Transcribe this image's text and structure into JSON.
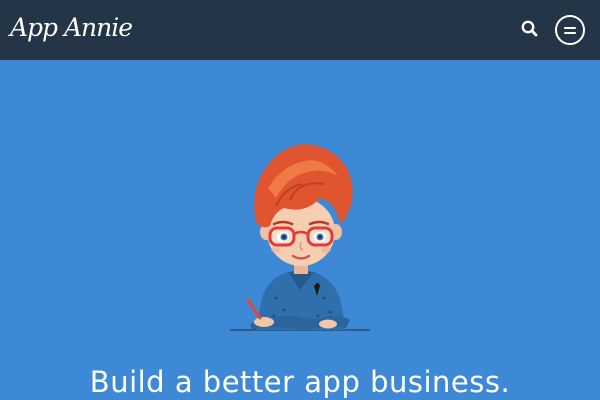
{
  "header": {
    "logo_text": "App Annie",
    "search_icon": "search-icon",
    "menu_icon": "hamburger-menu-icon",
    "background_color": "#243547"
  },
  "hero": {
    "illustration": "red-haired-woman-with-glasses-illustration",
    "headline": "Build a better app business.",
    "background_color": "#3d89d6"
  }
}
